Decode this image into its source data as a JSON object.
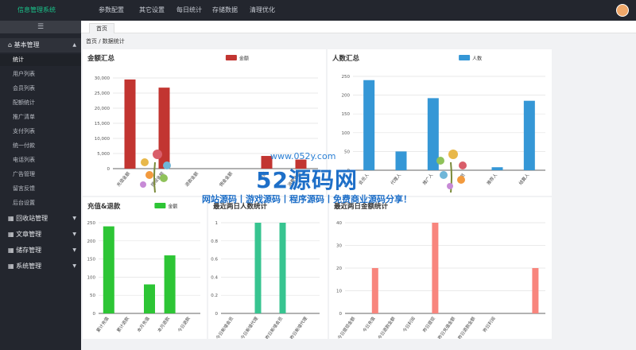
{
  "app": {
    "title": "信息管理系统"
  },
  "topnav": [
    "参数配置",
    "其它设置",
    "每日统计",
    "存储数据",
    "清理优化"
  ],
  "sidebar": {
    "groups": [
      {
        "label": "基本管理",
        "open": true,
        "items": [
          "统计",
          "用户列表",
          "会员列表",
          "配额统计",
          "推广清单",
          "支付列表",
          "统一付款",
          "电话列表",
          "广告管理",
          "留言反馈",
          "后台设置"
        ]
      },
      {
        "label": "回收站管理",
        "open": false,
        "items": []
      },
      {
        "label": "文章管理",
        "open": false,
        "items": []
      },
      {
        "label": "储存管理",
        "open": false,
        "items": []
      },
      {
        "label": "系统管理",
        "open": false,
        "items": []
      }
    ]
  },
  "tabs": [
    "首页"
  ],
  "breadcrumb": "首页 / 数据统计",
  "watermark": {
    "domain": "www.052y.com",
    "brand": "52源码网",
    "tagline": "网站源码丨游戏源码丨程序源码丨免费商业源码分享！"
  },
  "colors": {
    "red": "#c23531",
    "blue": "#3597d6",
    "green": "#2dc535",
    "teal": "#37c490",
    "salmon": "#f8857d"
  },
  "chart_data": [
    {
      "id": "amount",
      "type": "bar",
      "title": "金额汇总",
      "legend": "金额",
      "color": "#c23531",
      "categories": [
        "充值金额",
        "提现金额",
        "退款金额",
        "佣金金额",
        "转账",
        "消费金额"
      ],
      "values": [
        29500,
        26800,
        0,
        0,
        4200,
        3000
      ],
      "yticks": [
        0,
        5000,
        10000,
        15000,
        20000,
        25000,
        30000
      ],
      "ytick_labels": [
        "0",
        "5,000",
        "10,000",
        "15,000",
        "20,000",
        "25,000",
        "30,000"
      ],
      "ylim": [
        0,
        30000
      ]
    },
    {
      "id": "people",
      "type": "bar",
      "title": "人数汇总",
      "legend": "人数",
      "color": "#3597d6",
      "categories": [
        "会员人",
        "代理人",
        "推广人",
        "会员",
        "推荐人",
        "结算人"
      ],
      "values": [
        240,
        50,
        192,
        0,
        8,
        185
      ],
      "yticks": [
        0,
        50,
        100,
        150,
        200,
        250
      ],
      "ytick_labels": [
        "0",
        "50",
        "100",
        "150",
        "200",
        "250"
      ],
      "ylim": [
        0,
        250
      ]
    },
    {
      "id": "recharge",
      "type": "bar",
      "title": "充值&退款",
      "legend": "金额",
      "color": "#2dc535",
      "categories": [
        "累计充值",
        "累计退款",
        "本月充值",
        "本月退款",
        "今日退款"
      ],
      "values": [
        240,
        0,
        80,
        160,
        0
      ],
      "yticks": [
        0,
        50,
        100,
        150,
        200,
        250
      ],
      "ytick_labels": [
        "0",
        "50",
        "100",
        "150",
        "200",
        "250"
      ],
      "ylim": [
        0,
        250
      ]
    },
    {
      "id": "recent-people",
      "type": "bar",
      "title": "最近两日人数统计",
      "legend": "",
      "color": "#37c490",
      "categories": [
        "今日新增会员",
        "今日新增代理",
        "昨日新增会员",
        "昨日新增代理"
      ],
      "values": [
        0,
        1,
        1,
        0
      ],
      "yticks": [
        0,
        0.2,
        0.4,
        0.6,
        0.8,
        1
      ],
      "ytick_labels": [
        "0",
        "0.2",
        "0.4",
        "0.6",
        "0.8",
        "1"
      ],
      "ylim": [
        0,
        1
      ]
    },
    {
      "id": "recent-amount",
      "type": "bar",
      "title": "最近两日金额统计",
      "legend": "",
      "color": "#f8857d",
      "categories": [
        "今日提现金额",
        "今日充值",
        "今日退款金额",
        "今日利润",
        "昨日提现",
        "昨日充值金额",
        "昨日退款金额",
        "昨日利润"
      ],
      "values": [
        0,
        20,
        0,
        0,
        40,
        0,
        0,
        0,
        0,
        20
      ],
      "yticks": [
        0,
        10,
        20,
        30,
        40
      ],
      "ytick_labels": [
        "0",
        "10",
        "20",
        "30",
        "40"
      ],
      "ylim": [
        0,
        40
      ]
    }
  ]
}
